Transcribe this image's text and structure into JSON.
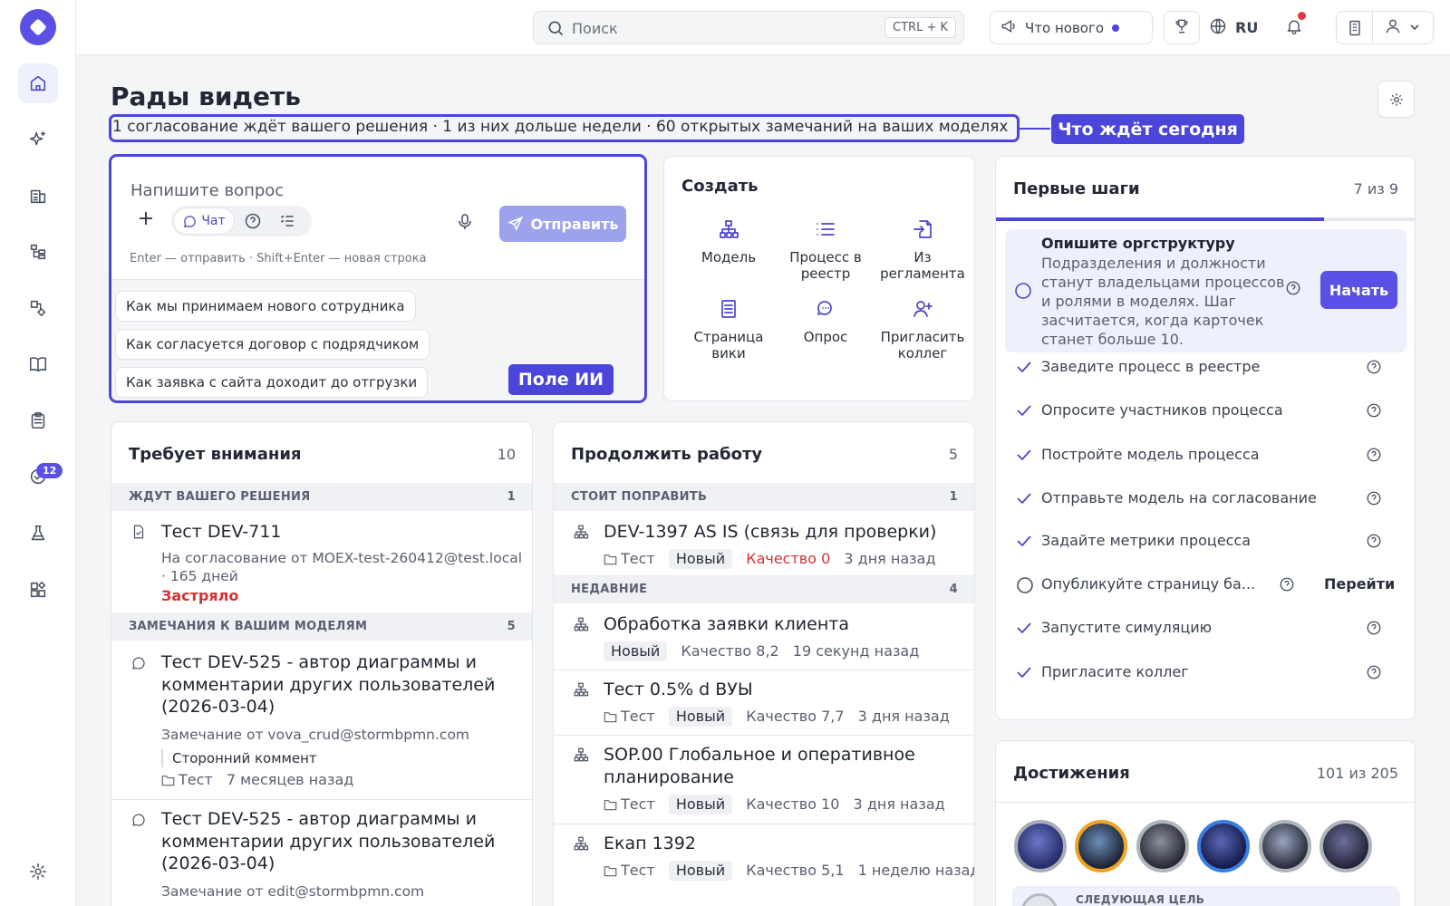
{
  "topbar": {
    "search_placeholder": "Поиск",
    "search_shortcut": "CTRL + K",
    "whats_new": "Что нового",
    "language": "RU"
  },
  "colors": {
    "accent": "#4b46d9",
    "brand": "#5b50e6",
    "danger": "#d63032"
  },
  "sidebar": {
    "items": [
      {
        "icon": "home-icon"
      },
      {
        "icon": "sparkles-icon"
      },
      {
        "icon": "building-icon"
      },
      {
        "icon": "hierarchy-icon"
      },
      {
        "icon": "shapes-icon"
      },
      {
        "icon": "book-icon"
      },
      {
        "icon": "clipboard-icon"
      },
      {
        "icon": "check-circle-icon"
      },
      {
        "icon": "flask-icon"
      },
      {
        "icon": "widgets-icon"
      },
      {
        "icon": "gear-icon"
      }
    ],
    "approvals_badge": "12"
  },
  "page": {
    "title": "Рады видеть",
    "summary": "1 согласование ждёт вашего решения · 1 из них дольше недели · 60 открытых замечаний на ваших моделях",
    "summary_callout": "Что ждёт сегодня"
  },
  "ai": {
    "placeholder": "Напишите вопрос",
    "chat_label": "Чат",
    "send_label": "Отправить",
    "hint": "Enter — отправить · Shift+Enter — новая строка",
    "suggestions": [
      "Как мы принимаем нового сотрудника",
      "Как согласуется договор с подрядчиком",
      "Как заявка с сайта доходит до отгрузки"
    ],
    "callout": "Поле ИИ"
  },
  "create": {
    "title": "Создать",
    "items": [
      {
        "label": "Модель",
        "icon": "model-icon"
      },
      {
        "label": "Процесс в реестр",
        "icon": "list-icon"
      },
      {
        "label": "Из регламента",
        "icon": "import-icon"
      },
      {
        "label": "Страница вики",
        "icon": "page-icon"
      },
      {
        "label": "Опрос",
        "icon": "survey-icon"
      },
      {
        "label": "Пригласить коллег",
        "icon": "invite-icon"
      }
    ]
  },
  "attention": {
    "title": "Требует внимания",
    "count": "10",
    "sections": [
      {
        "label": "ЖДУТ ВАШЕГО РЕШЕНИЯ",
        "count": "1"
      },
      {
        "label": "ЗАМЕЧАНИЯ К ВАШИМ МОДЕЛЯМ",
        "count": "5"
      }
    ],
    "approval": {
      "title": "Тест DEV-711",
      "line1": "На согласование от MOEX-test-260412@test.local",
      "line2": "· 165 дней",
      "status": "Застряло"
    },
    "comments": [
      {
        "title1": "Тест DEV-525 - автор диаграммы и",
        "title2": "комментарии других пользователей",
        "title3": "(2026-03-04)",
        "from": "Замечание от vova_crud@stormbpmn.com",
        "quote": "Сторонний коммент",
        "folder": "Тест",
        "time": "7 месяцев назад"
      },
      {
        "title1": "Тест DEV-525 - автор диаграммы и",
        "title2": "комментарии других пользователей",
        "title3": "(2026-03-04)",
        "from": "Замечание от edit@stormbpmn.com"
      }
    ]
  },
  "continue": {
    "title": "Продолжить работу",
    "count": "5",
    "sections": [
      {
        "label": "СТОИТ ПОПРАВИТЬ",
        "count": "1"
      },
      {
        "label": "НЕДАВНИЕ",
        "count": "4"
      }
    ],
    "items": [
      {
        "title": "DEV-1397 AS IS (связь для проверки)",
        "folder": "Тест",
        "status": "Новый",
        "quality": "Качество 0",
        "time": "3 дня назад"
      },
      {
        "title": "Обработка заявки клиента",
        "status": "Новый",
        "quality": "Качество 8,2",
        "time": "19 секунд назад"
      },
      {
        "title": "Тест 0.5% d ВУЫ",
        "folder": "Тест",
        "status": "Новый",
        "quality": "Качество 7,7",
        "time": "3 дня назад"
      },
      {
        "title1": "SOP.00 Глобальное и оперативное",
        "title2": "планирование",
        "folder": "Тест",
        "status": "Новый",
        "quality": "Качество 10",
        "time": "3 дня назад"
      },
      {
        "title": "Екап 1392",
        "folder": "Тест",
        "status": "Новый",
        "quality": "Качество 5,1",
        "time": "1 неделю назад"
      }
    ]
  },
  "first_steps": {
    "title": "Первые шаги",
    "count": "7 из 9",
    "progress": 0.78,
    "current": {
      "title": "Опишите оргструктуру",
      "desc": [
        "Подразделения и должности",
        "станут владельцами процессов",
        "и ролями в моделях. Шаг",
        "засчитается, когда карточек",
        "станет больше 10."
      ],
      "action": "Начать"
    },
    "steps": [
      {
        "label": "Заведите процесс в реестре",
        "done": true
      },
      {
        "label": "Опросите участников процесса",
        "done": true
      },
      {
        "label": "Постройте модель процесса",
        "done": true
      },
      {
        "label": "Отправьте модель на согласование",
        "done": true
      },
      {
        "label": "Задайте метрики процесса",
        "done": true
      },
      {
        "label": "Опубликуйте страницу ба...",
        "done": false,
        "action": "Перейти"
      },
      {
        "label": "Запустите симуляцию",
        "done": true
      },
      {
        "label": "Пригласите коллег",
        "done": true
      }
    ]
  },
  "achievements": {
    "title": "Достижения",
    "count": "101 из 205",
    "next_goal": "СЛЕДУЮЩАЯ ЦЕЛЬ"
  }
}
